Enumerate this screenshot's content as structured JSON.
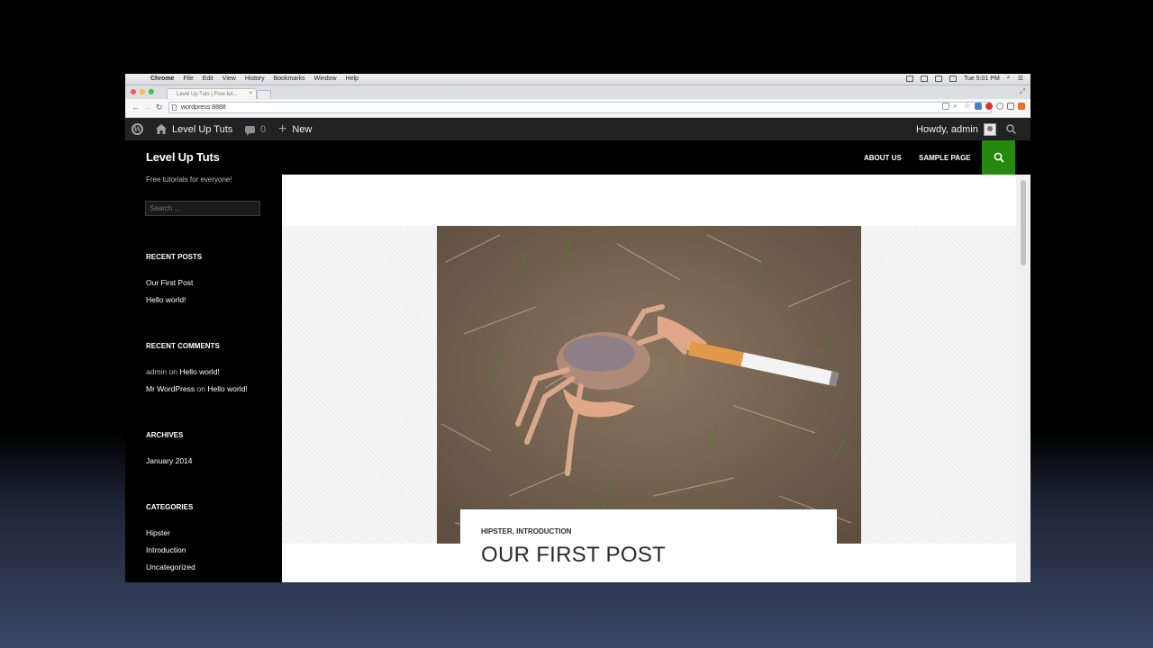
{
  "mac_menubar": {
    "apple_glyph": "",
    "menus": [
      "Chrome",
      "File",
      "Edit",
      "View",
      "History",
      "Bookmarks",
      "Window",
      "Help"
    ],
    "clock": "Tue 5:01 PM"
  },
  "browser": {
    "tab_title": "Level Up Tuts | Free tut...",
    "tab_close": "×",
    "url": "wordpress:8888"
  },
  "admin_bar": {
    "site_name": "Level Up Tuts",
    "comments_count": "0",
    "new_label": "New",
    "greeting": "Howdy, admin"
  },
  "site": {
    "title": "Level Up Tuts",
    "tagline": "Free tutorials for everyone!",
    "search_placeholder": "Search …",
    "nav": [
      "About Us",
      "Sample Page"
    ]
  },
  "sidebar": {
    "recent_posts": {
      "title": "RECENT POSTS",
      "items": [
        "Our First Post",
        "Hello world!"
      ]
    },
    "recent_comments": {
      "title": "RECENT COMMENTS",
      "items": [
        {
          "author": "admin",
          "on": "on",
          "post": "Hello world!"
        },
        {
          "author": "Mr WordPress",
          "on": "on",
          "post": "Hello world!"
        }
      ]
    },
    "archives": {
      "title": "ARCHIVES",
      "items": [
        "January 2014"
      ]
    },
    "categories": {
      "title": "CATEGORIES",
      "items": [
        "Hipster",
        "Introduction",
        "Uncategorized"
      ]
    }
  },
  "post": {
    "categories": "HIPSTER, INTRODUCTION",
    "title": "OUR FIRST POST"
  },
  "colors": {
    "accent_green": "#24890d",
    "admin_bar": "#222222",
    "sidebar_bg": "#000000"
  }
}
